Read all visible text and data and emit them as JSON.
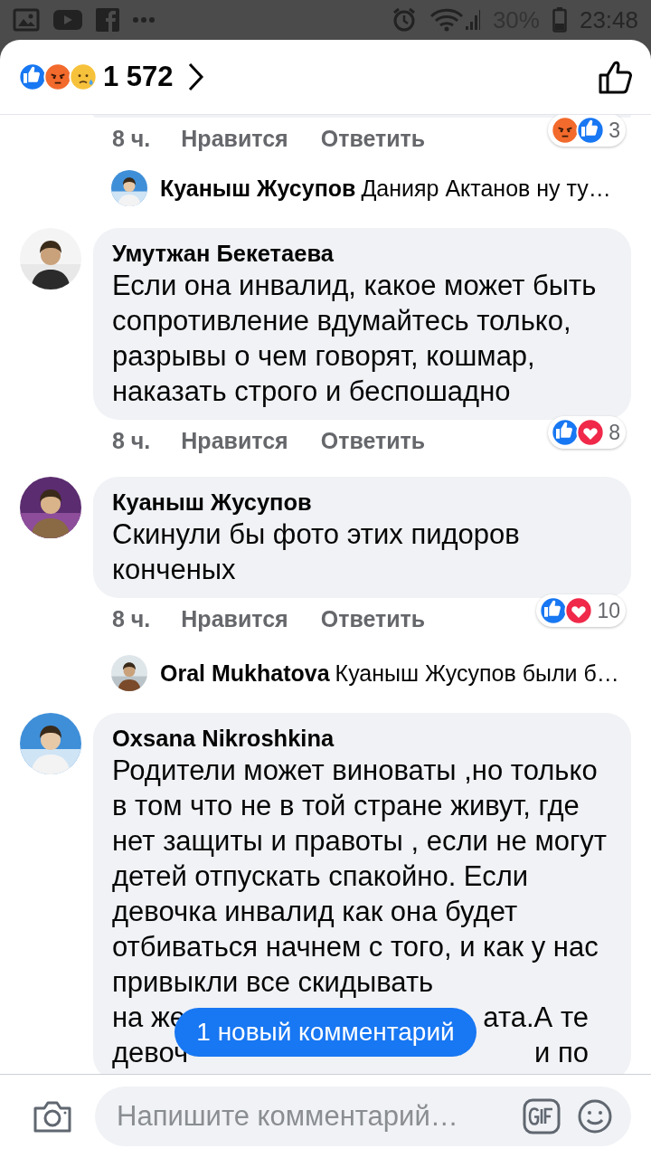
{
  "status_bar": {
    "battery": "30%",
    "time": "23:48"
  },
  "header": {
    "reactions": [
      {
        "kind": "like"
      },
      {
        "kind": "angry"
      },
      {
        "kind": "sad"
      }
    ],
    "count": "1 572"
  },
  "comments": [
    {
      "kind": "tail",
      "time": "8 ч.",
      "like_label": "Нравится",
      "reply_label": "Ответить",
      "reactions": {
        "types": [
          {
            "kind": "angry"
          },
          {
            "kind": "like"
          }
        ],
        "count": "3"
      },
      "reply_preview": {
        "author": "Куаныш Жусупов",
        "text": "Данияр Актанов ну ту…"
      }
    },
    {
      "kind": "full",
      "author": "Умутжан Бекетаева",
      "text": "Если она инвалид, какое может быть сопротивление вдумайтесь только, разрывы о чем говорят, кошмар, наказать строго и беспошадно",
      "time": "8 ч.",
      "like_label": "Нравится",
      "reply_label": "Ответить",
      "reactions": {
        "types": [
          {
            "kind": "like"
          },
          {
            "kind": "love"
          }
        ],
        "count": "8"
      }
    },
    {
      "kind": "full",
      "author": "Куаныш Жусупов",
      "text": "Скинули бы фото этих пидоров конченых",
      "time": "8 ч.",
      "like_label": "Нравится",
      "reply_label": "Ответить",
      "reactions": {
        "types": [
          {
            "kind": "like"
          },
          {
            "kind": "love"
          }
        ],
        "count": "10"
      },
      "reply_preview": {
        "author": "Oral Mukhatova",
        "text": "Куаныш Жусупов были б…"
      }
    },
    {
      "kind": "full",
      "author": "Oxsana Nikroshkina",
      "text": "Родители может виноваты ,но только в том что не в той стране живут, где нет защиты и правоты , если не могут детей отпускать спакойно. Если девочка инвалид как она будет отбиваться начнем с того, и как у нас привыкли все скидывать",
      "partial_lines": [
        {
          "left": "на же",
          "right": "ата.А те"
        },
        {
          "left": "девоч",
          "right": "и по"
        }
      ]
    }
  ],
  "new_comments_pill": "1 новый комментарий",
  "composer": {
    "placeholder": "Напишите комментарий…"
  }
}
